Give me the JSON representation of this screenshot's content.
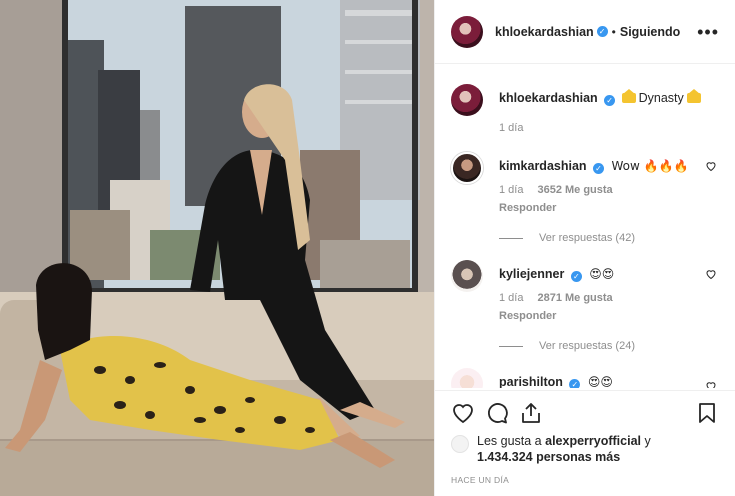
{
  "header": {
    "username": "khloekardashian",
    "separator": "•",
    "follow_status": "Siguiendo",
    "more_label": "•••"
  },
  "caption": {
    "username": "khloekardashian",
    "text": "Dynasty",
    "time": "1 día"
  },
  "comments": [
    {
      "username": "kimkardashian",
      "text": "Wow 🔥🔥🔥",
      "time": "1 día",
      "likes": "3652 Me gusta",
      "reply": "Responder",
      "view_replies": "Ver respuestas (42)"
    },
    {
      "username": "kyliejenner",
      "text": "😍😍",
      "time": "1 día",
      "likes": "2871 Me gusta",
      "reply": "Responder",
      "view_replies": "Ver respuestas (24)"
    },
    {
      "username": "parishilton",
      "text": "😍😍"
    }
  ],
  "likes": {
    "prefix": "Les gusta a",
    "user": "alexperryofficial",
    "suffix": "y",
    "count": "1.434.324 personas más"
  },
  "timestamp": "Hace un día",
  "colors": {
    "verified": "#3897f0",
    "secondary_text": "#8e8e8e",
    "primary_text": "#262626",
    "border": "#efefef"
  },
  "icons": [
    "heart-icon",
    "comment-icon",
    "share-icon",
    "bookmark-icon",
    "verified-badge-icon",
    "crown-icon",
    "ellipsis-icon"
  ]
}
